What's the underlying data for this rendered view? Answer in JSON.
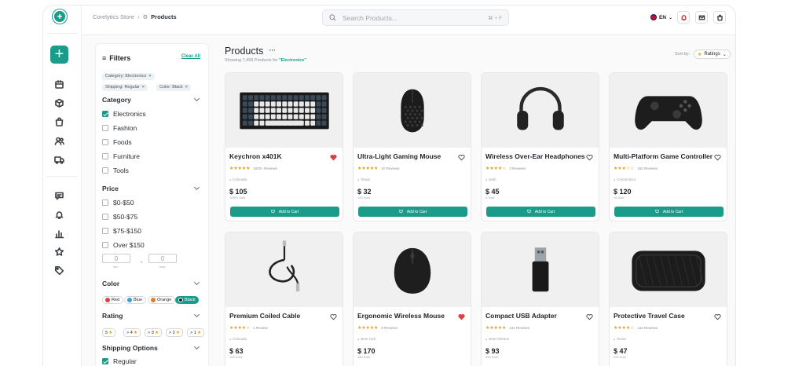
{
  "colors": {
    "accent": "#1b9b8a",
    "heart_active": "#d64545",
    "star": "#e3a21a"
  },
  "topbar": {
    "breadcrumb_root": "Corelytics Store",
    "breadcrumb_current": "Products",
    "search_placeholder": "Search Products...",
    "search_shortcut": "⌘ + F",
    "language": "EN"
  },
  "rail": {
    "new_label": "+",
    "icons": [
      "calendar-icon",
      "box-icon",
      "shopping-bag-icon",
      "users-icon",
      "truck-icon",
      "chat-icon",
      "bell-icon",
      "bar-chart-icon",
      "star-icon",
      "tag-icon"
    ]
  },
  "filters": {
    "title": "Filters",
    "clear_all": "Clear All",
    "active": [
      "Category: Electronics",
      "Shipping: Regular",
      "Color: Black"
    ],
    "category": {
      "title": "Category",
      "options": [
        {
          "label": "Electronics",
          "checked": true
        },
        {
          "label": "Fashion",
          "checked": false
        },
        {
          "label": "Foods",
          "checked": false
        },
        {
          "label": "Furniture",
          "checked": false
        },
        {
          "label": "Tools",
          "checked": false
        }
      ]
    },
    "price": {
      "title": "Price",
      "options": [
        {
          "label": "$0-$50",
          "checked": false
        },
        {
          "label": "$50-$75",
          "checked": false
        },
        {
          "label": "$75-$150",
          "checked": false
        },
        {
          "label": "Over $150",
          "checked": false
        }
      ],
      "min_value": "0",
      "max_value": "0",
      "min_label": "min",
      "max_label": "max",
      "separator": "-"
    },
    "color": {
      "title": "Color",
      "options": [
        {
          "label": "Red",
          "swatch": "#d64545"
        },
        {
          "label": "Blue",
          "swatch": "#3aa0d8"
        },
        {
          "label": "Orange",
          "swatch": "#e07b2a"
        },
        {
          "label": "Black",
          "swatch": "#1f2328",
          "selected": true
        }
      ]
    },
    "rating": {
      "title": "Rating",
      "options": [
        "5",
        "> 4",
        "> 3",
        "> 2",
        "> 1"
      ]
    },
    "shipping": {
      "title": "Shipping Options",
      "options": [
        {
          "label": "Regular",
          "checked": true
        }
      ]
    }
  },
  "main": {
    "title": "Products",
    "more": "···",
    "showing_prefix": "Showing 7,456 Products for ",
    "showing_keyword": "\"Electronics\"",
    "sort_label": "Sort by:",
    "sort_value": "Ratings",
    "cart_label": "Add to Cart"
  },
  "products": [
    {
      "name": "Keychron x401K",
      "stars": "★★★★★",
      "reviews": "1000+ Reviews",
      "location": "Colorado",
      "price": "$ 105",
      "sold": "1000+ Sold",
      "liked": true,
      "image": "keyboard"
    },
    {
      "name": "Ultra-Light Gaming Mouse",
      "stars": "★★★★★",
      "reviews": "10 Reviews",
      "location": "Texas",
      "price": "$ 32",
      "sold": "120 Sold",
      "liked": false,
      "image": "mouse"
    },
    {
      "name": "Wireless Over-Ear Headphones",
      "stars": "★★★★☆",
      "reviews": "3 Reviews",
      "location": "Utah",
      "price": "$ 45",
      "sold": "6 Sold",
      "liked": false,
      "image": "headphones"
    },
    {
      "name": "Multi-Platform Game Controller",
      "stars": "★★★☆☆",
      "reviews": "150 Reviews",
      "location": "Connecticut",
      "price": "$ 120",
      "sold": "76 Sold",
      "liked": false,
      "image": "controller"
    },
    {
      "name": "Premium Coiled Cable",
      "stars": "★★★★☆",
      "reviews": "1 Review",
      "location": "Colorado",
      "price": "$ 63",
      "sold": "126 Sold",
      "liked": false,
      "image": "cable"
    },
    {
      "name": "Ergonomic Wireless Mouse",
      "stars": "★★★★★",
      "reviews": "8 Reviews",
      "location": "New York",
      "price": "$ 170",
      "sold": "180 Sold",
      "liked": true,
      "image": "ergomouse"
    },
    {
      "name": "Compact USB Adapter",
      "stars": "★★★★★",
      "reviews": "131 Reviews",
      "location": "New Orleans",
      "price": "$ 93",
      "sold": "250 Sold",
      "liked": false,
      "image": "usb"
    },
    {
      "name": "Protective Travel Case",
      "stars": "★★★★☆",
      "reviews": "134 Reviews",
      "location": "Texas",
      "price": "$ 47",
      "sold": "220 Sold",
      "liked": false,
      "image": "case"
    }
  ]
}
